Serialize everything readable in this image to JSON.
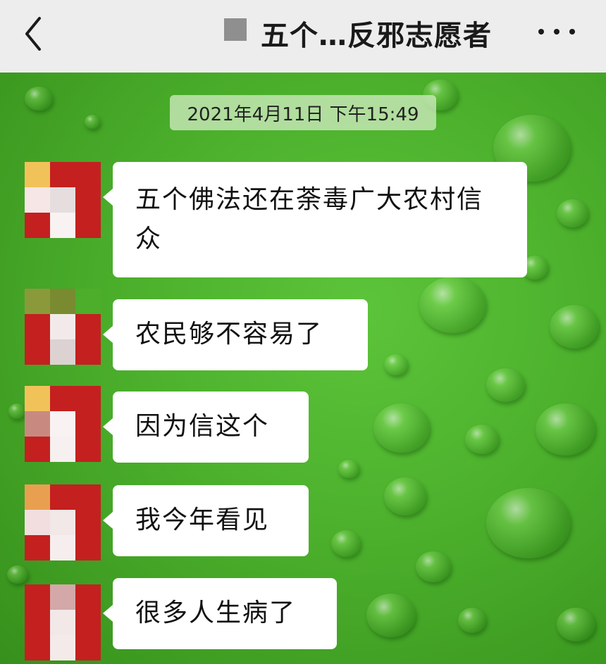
{
  "header": {
    "title": "五个…反邪志愿者",
    "back_icon": "chevron-left-icon",
    "more_icon": "more-dots-icon"
  },
  "chat": {
    "timestamp": "2021年4月11日 下午15:49",
    "messages": [
      {
        "text": "五个佛法还在荼毒广大农村信众"
      },
      {
        "text": "农民够不容易了"
      },
      {
        "text": "因为信这个"
      },
      {
        "text": "我今年看见"
      },
      {
        "text": "很多人生病了"
      }
    ]
  },
  "colors": {
    "header_bg": "#ededed",
    "chat_bg": "#4cb02c",
    "bubble_bg": "#ffffff",
    "timestamp_bg": "#cdebbe"
  }
}
